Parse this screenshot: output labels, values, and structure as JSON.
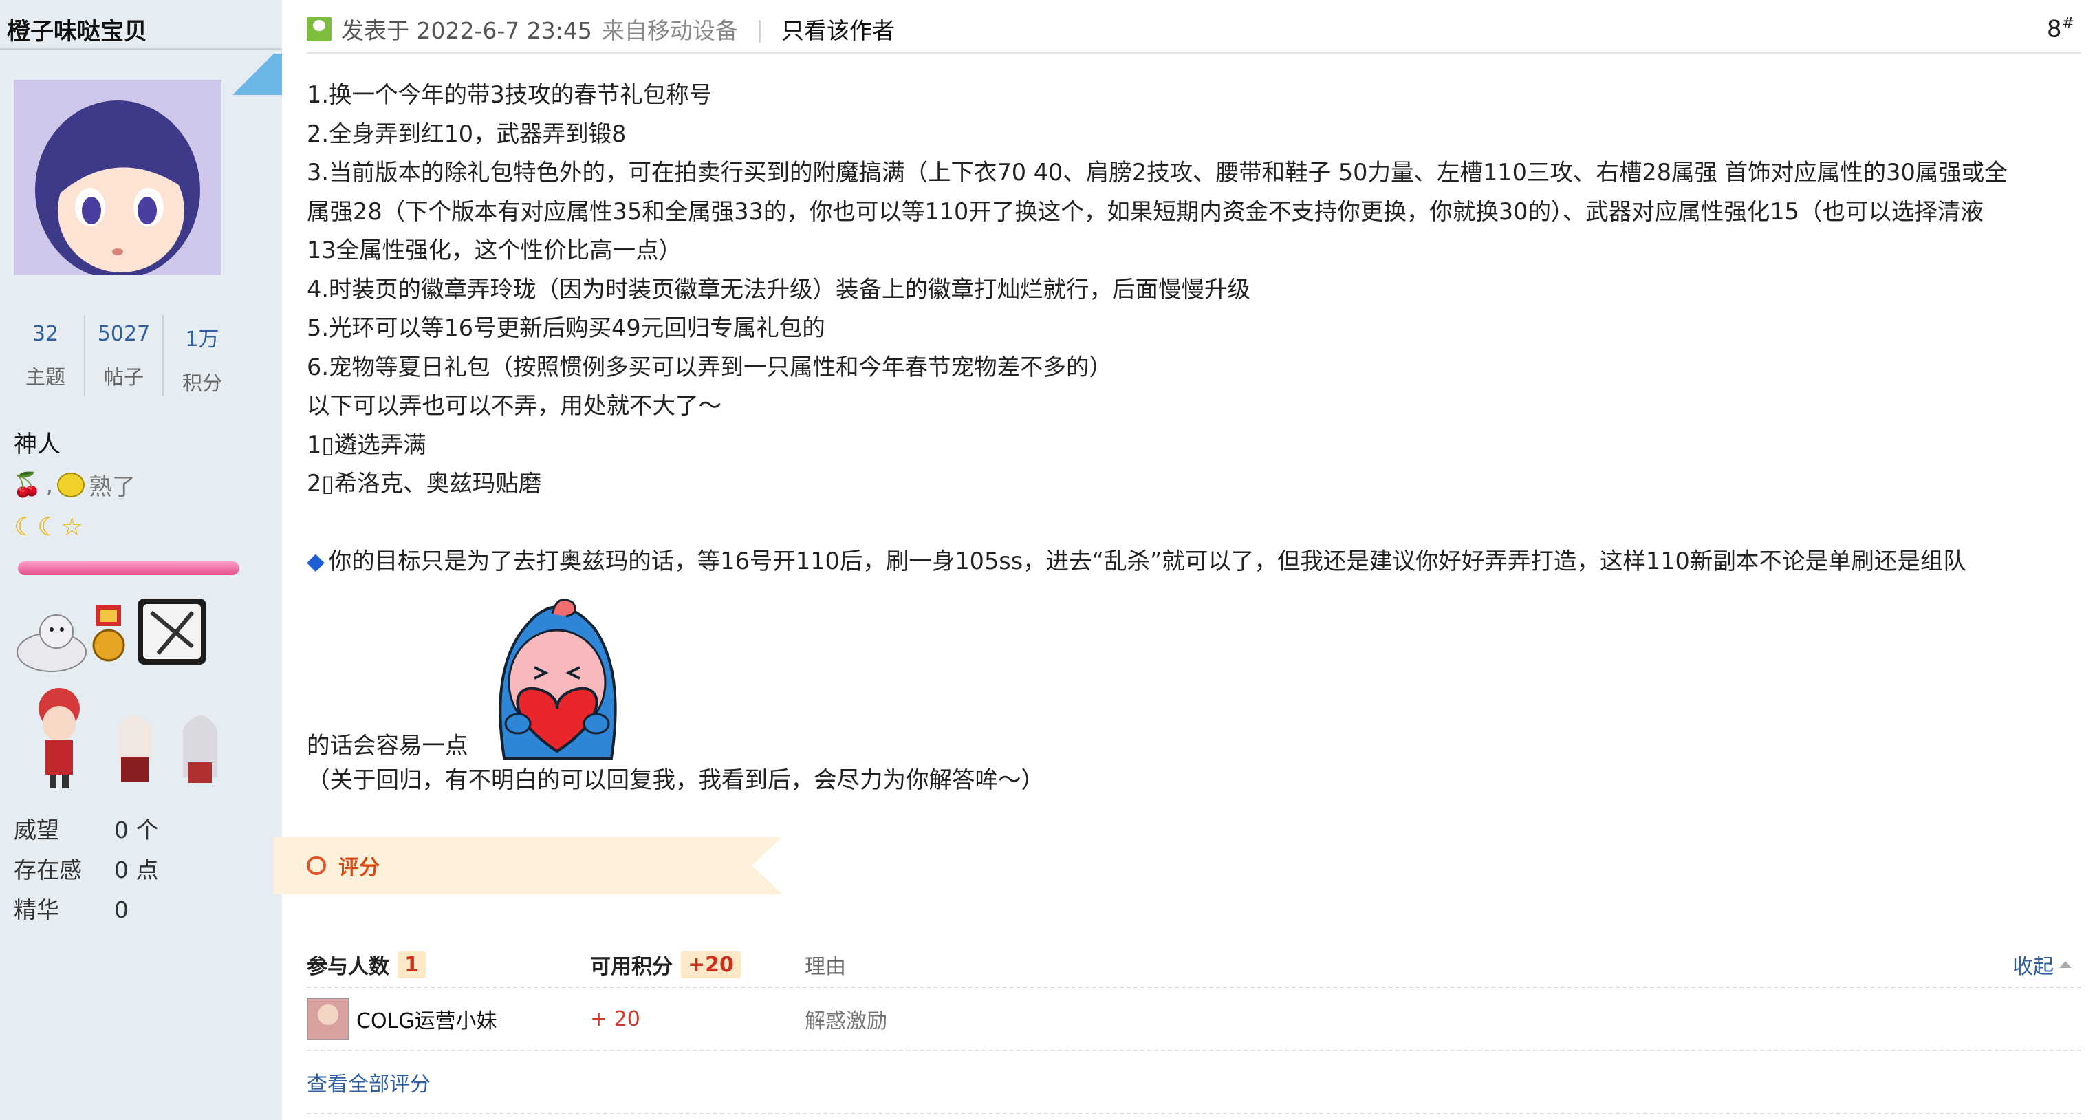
{
  "author": {
    "name": "橙子味哒宝贝",
    "stats": [
      {
        "value": "32",
        "label": "主题"
      },
      {
        "value": "5027",
        "label": "帖子"
      },
      {
        "value": "1万",
        "label": "积分"
      }
    ],
    "rank": "神人",
    "medal_text": "熟了",
    "info": [
      {
        "key": "威望",
        "value": "0 个"
      },
      {
        "key": "存在感",
        "value": "0 点"
      },
      {
        "key": "精华",
        "value": "0"
      }
    ]
  },
  "post": {
    "posted": "发表于 2022-6-7 23:45",
    "device": "来自移动设备",
    "divider": "|",
    "only_author": "只看该作者",
    "floor": "8",
    "floor_mark": "#",
    "lines": [
      "1.换一个今年的带3技攻的春节礼包称号",
      "2.全身弄到红10，武器弄到锻8",
      "3.当前版本的除礼包特色外的，可在拍卖行买到的附魔搞满（上下衣70 40、肩膀2技攻、腰带和鞋子 50力量、左槽110三攻、右槽28属强 首饰对应属性的30属强或全",
      "属强28（下个版本有对应属性35和全属强33的，你也可以等110开了换这个，如果短期内资金不支持你更换，你就换30的）、武器对应属性强化15（也可以选择清液",
      "13全属性强化，这个性价比高一点）",
      "4.时装页的徽章弄玲珑（因为时装页徽章无法升级）装备上的徽章打灿烂就行，后面慢慢升级",
      "5.光环可以等16号更新后购买49元回归专属礼包的",
      "6.宠物等夏日礼包（按照惯例多买可以弄到一只属性和今年春节宠物差不多的）",
      "以下可以弄也可以不弄，用处就不大了～",
      "1▯遴选弄满",
      "2▯希洛克、奥兹玛贴磨"
    ],
    "diamond": "◆",
    "goal_line": "你的目标只是为了去打奥兹玛的话，等16号开110后，刷一身105ss，进去“乱杀”就可以了，但我还是建议你好好弄弄打造，这样110新副本不论是单刷还是组队",
    "easier": "的话会容易一点",
    "closing": "（关于回归，有不明白的可以回复我，我看到后，会尽力为你解答哞～）"
  },
  "rating": {
    "title": "评分",
    "participants_label": "参与人数",
    "participants": "1",
    "points_label": "可用积分",
    "points_total": "+20",
    "reason_label": "理由",
    "collapse": "收起",
    "entries": [
      {
        "user": "COLG运营小妹",
        "points": "+ 20",
        "reason": "解惑激励"
      }
    ],
    "view_all": "查看全部评分"
  }
}
